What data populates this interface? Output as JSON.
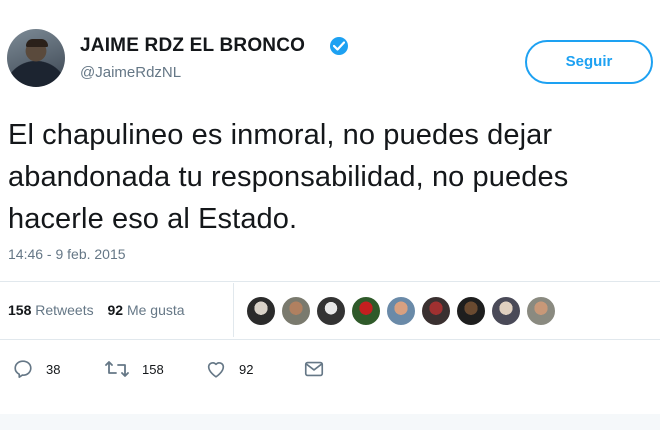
{
  "user": {
    "name": "JAIME RDZ EL BRONCO",
    "handle": "@JaimeRdzNL"
  },
  "follow_button": {
    "label": "Seguir"
  },
  "tweet": {
    "text": "El chapulineo es inmoral, no puedes dejar abandonada tu responsabilidad, no puedes hacerle eso al Estado.",
    "timestamp": "14:46 - 9 feb. 2015"
  },
  "stats": {
    "retweets_count": "158",
    "retweets_label": "Retweets",
    "likes_count": "92",
    "likes_label": "Me gusta"
  },
  "actions": {
    "replies": "38",
    "retweets": "158",
    "likes": "92"
  },
  "colors": {
    "accent": "#1da1f2",
    "text": "#14171a",
    "muted": "#657786"
  },
  "icons": [
    "verified-badge-icon",
    "reply-icon",
    "retweet-icon",
    "like-icon",
    "direct-message-icon"
  ]
}
